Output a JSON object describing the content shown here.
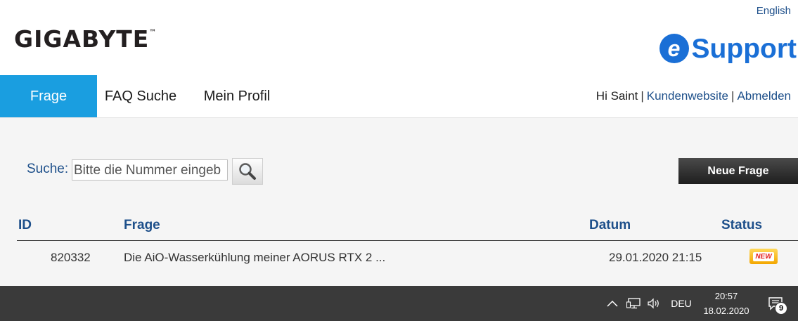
{
  "header": {
    "logo_text": "GIGABYTE",
    "logo_tm": "™",
    "language": "English",
    "esupport_e": "e",
    "esupport_text": "Support"
  },
  "nav": {
    "tabs": [
      {
        "label": "Frage",
        "active": true
      },
      {
        "label": "FAQ Suche",
        "active": false
      },
      {
        "label": "Mein Profil",
        "active": false
      }
    ],
    "greeting": "Hi Saint",
    "customer_site": "Kundenwebsite",
    "logout": "Abmelden"
  },
  "search": {
    "label": "Suche:",
    "placeholder": "Bitte die Nummer eingeb",
    "new_question_button": "Neue Frage"
  },
  "table": {
    "headers": {
      "id": "ID",
      "question": "Frage",
      "date": "Datum",
      "status": "Status"
    },
    "rows": [
      {
        "id": "820332",
        "question": "Die AiO-Wasserkühlung meiner AORUS RTX 2 ...",
        "date": "29.01.2020 21:15",
        "status_badge": "NEW"
      }
    ]
  },
  "taskbar": {
    "language": "DEU",
    "time": "20:57",
    "date": "18.02.2020",
    "notifications": "9",
    "icons": [
      "chevron-up-icon",
      "network-icon",
      "volume-icon",
      "notification-icon"
    ]
  },
  "colors": {
    "accent_blue": "#1a9ee0",
    "link_blue": "#1d4f8a",
    "esupport_blue": "#1a6fd6",
    "taskbar": "#3a3a3a"
  }
}
